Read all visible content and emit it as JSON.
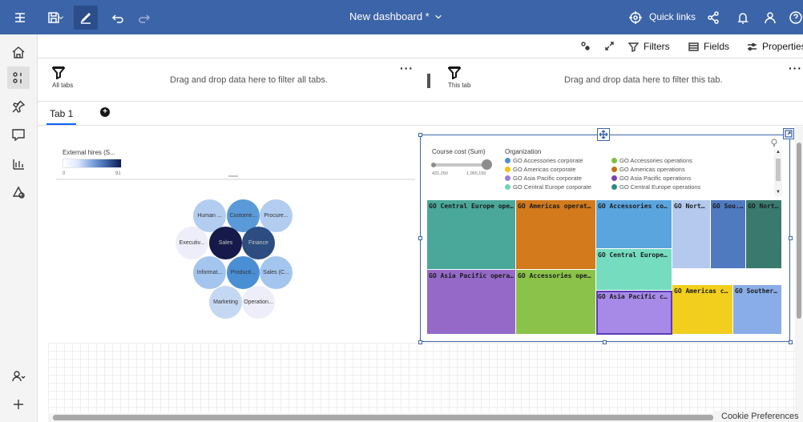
{
  "header": {
    "title": "New dashboard *",
    "quick_links": "Quick links"
  },
  "toolbar": {
    "filters": "Filters",
    "fields": "Fields",
    "properties": "Properties"
  },
  "filterbar": {
    "all_tabs_label": "All tabs",
    "all_tabs_hint": "Drag and drop data here to filter all tabs.",
    "this_tab_label": "This tab",
    "this_tab_hint": "Drag and drop data here to filter this tab.",
    "more": "···"
  },
  "tabs": [
    {
      "label": "Tab 1",
      "active": true
    }
  ],
  "add_tab": "+",
  "bubble_chart": {
    "legend_title": "External hires (S...",
    "legend_min": "0",
    "legend_max": "91",
    "bubbles": [
      {
        "label": "Human ...",
        "color": "#b3cdf0"
      },
      {
        "label": "Custome...",
        "color": "#5a9ad9"
      },
      {
        "label": "Procure...",
        "color": "#b3cdf0"
      },
      {
        "label": "Executiv...",
        "color": "#eeeefa"
      },
      {
        "label": "Sales",
        "color": "#161a4a"
      },
      {
        "label": "Finance",
        "color": "#2d4d80"
      },
      {
        "label": "Informat...",
        "color": "#a4c5ee"
      },
      {
        "label": "Producti...",
        "color": "#4a8fd4"
      },
      {
        "label": "Sales (C...",
        "color": "#a4c5ee"
      },
      {
        "label": "Marketing",
        "color": "#c5d8f3"
      },
      {
        "label": "Operation...",
        "color": "#eeeefa"
      }
    ]
  },
  "treemap": {
    "size_legend_title": "Course cost (Sum)",
    "size_min": "431,250",
    "size_max": "1,065,150",
    "color_legend_title": "Organization",
    "legend_items": [
      {
        "label": "GO Accessories corporate",
        "color": "#4a8fd4"
      },
      {
        "label": "GO Accessories operations",
        "color": "#7ac143"
      },
      {
        "label": "GO Americas corporate",
        "color": "#f1c40f"
      },
      {
        "label": "GO Americas operations",
        "color": "#c96e14"
      },
      {
        "label": "GO Asia Pacific corporate",
        "color": "#9b7be0"
      },
      {
        "label": "GO Asia Pacific operations",
        "color": "#7a3fb5"
      },
      {
        "label": "GO Central Europe corporate",
        "color": "#6fd5b8"
      },
      {
        "label": "GO Central Europe operations",
        "color": "#2e8b80"
      }
    ],
    "cells": [
      {
        "label": "GO Central Europe oper...",
        "color": "#4aa89a"
      },
      {
        "label": "GO Americas operati...",
        "color": "#d27a1c"
      },
      {
        "label": "GO Accessories cor...",
        "color": "#5aa5de"
      },
      {
        "label": "GO Nort...",
        "color": "#b5c9ee"
      },
      {
        "label": "GO Sou...",
        "color": "#4f7ac0"
      },
      {
        "label": "GO Nort...",
        "color": "#3a7a6e"
      },
      {
        "label": "GO Central Europe ...",
        "color": "#76dcc0"
      },
      {
        "label": "GO Asia Pacific operatio...",
        "color": "#9469c7"
      },
      {
        "label": "GO Accessories oper...",
        "color": "#8bc34a"
      },
      {
        "label": "GO Asia Pacific cor...",
        "color": "#a78ae8"
      },
      {
        "label": "GO Americas c...",
        "color": "#f2cf1d"
      },
      {
        "label": "GO Souther...",
        "color": "#89ade8"
      }
    ]
  },
  "cookie": "Cookie Preferences"
}
